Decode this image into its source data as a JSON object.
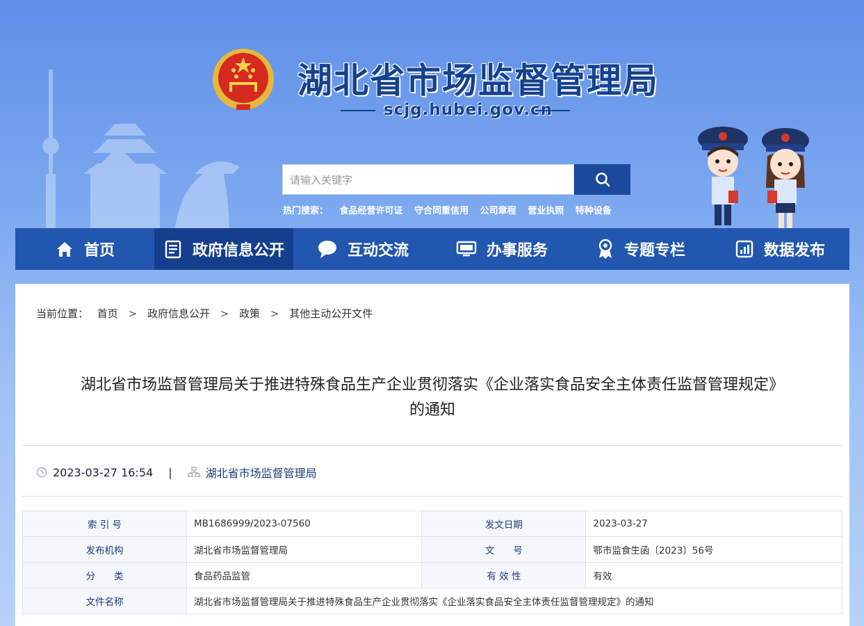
{
  "header": {
    "site_title": "湖北省市场监督管理局",
    "domain": "scjg.hubei.gov.cn",
    "search_placeholder": "请输入关键字",
    "hot_label": "热门搜索：",
    "hot_terms": [
      "食品经营许可证",
      "守合同重信用",
      "公司章程",
      "营业执照",
      "特种设备"
    ]
  },
  "nav": [
    {
      "label": "首页",
      "icon": "home-icon"
    },
    {
      "label": "政府信息公开",
      "icon": "document-icon"
    },
    {
      "label": "互动交流",
      "icon": "chat-icon"
    },
    {
      "label": "办事服务",
      "icon": "monitor-icon"
    },
    {
      "label": "专题专栏",
      "icon": "award-icon"
    },
    {
      "label": "数据发布",
      "icon": "chart-icon"
    }
  ],
  "breadcrumb": {
    "label": "当前位置：",
    "items": [
      "首页",
      "政府信息公开",
      "政策",
      "其他主动公开文件"
    ]
  },
  "article": {
    "title_line1": "湖北省市场监督管理局关于推进特殊食品生产企业贯彻落实《企业落实食品安全主体责任监督管理规定》",
    "title_line2": "的通知",
    "datetime": "2023-03-27 16:54",
    "separator": "|",
    "source": "湖北省市场监督管理局"
  },
  "info_table": {
    "rows": [
      {
        "k1": "索 引 号",
        "v1": "MB1686999/2023-07560",
        "k2": "发文日期",
        "v2": "2023-03-27"
      },
      {
        "k1": "发布机构",
        "v1": "湖北省市场监督管理局",
        "k2": "文　　号",
        "v2": "鄂市监食生函〔2023〕56号"
      },
      {
        "k1": "分　　类",
        "v1": "食品药品监管",
        "k2": "有 效 性",
        "v2": "有效"
      }
    ],
    "name_label": "文件名称",
    "name_value": "湖北省市场监督管理局关于推进特殊食品生产企业贯彻落实《企业落实食品安全主体责任监督管理规定》的通知"
  },
  "colors": {
    "nav_bg": "#2257b0",
    "nav_active": "#153f8d",
    "title_blue": "#15418f"
  }
}
